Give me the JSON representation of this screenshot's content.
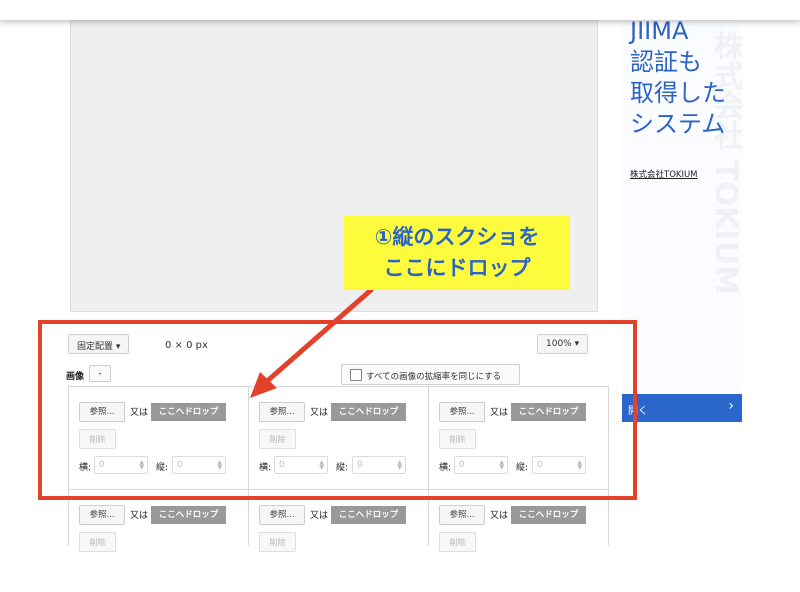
{
  "ad": {
    "title_lines": [
      "JIIMA",
      "認証も",
      "取得した",
      "システム"
    ],
    "company": "株式会社TOKIUM",
    "watermark": "株式会社 TOKIUM",
    "open_button": "開く",
    "brand_color": "#2c63c5"
  },
  "toolbar": {
    "placement": "固定配置 ▾",
    "size": "0 × 0 px",
    "zoom": "100% ▾"
  },
  "images": {
    "label": "画像",
    "minus_button": "-",
    "same_scale_checkbox": "すべての画像の拡縮率を同じにする"
  },
  "cell": {
    "browse": "参照...",
    "or": "又は",
    "drop_here": "ここへドロップ",
    "delete": "削除",
    "width_label": "横:",
    "height_label": "縦:",
    "width_placeholder": "0",
    "height_placeholder": "0"
  },
  "callout": {
    "line1": "①縦のスクショを",
    "line2": "ここにドロップ",
    "highlight_color": "#e3412a",
    "background_color": "#fdfb3c"
  }
}
